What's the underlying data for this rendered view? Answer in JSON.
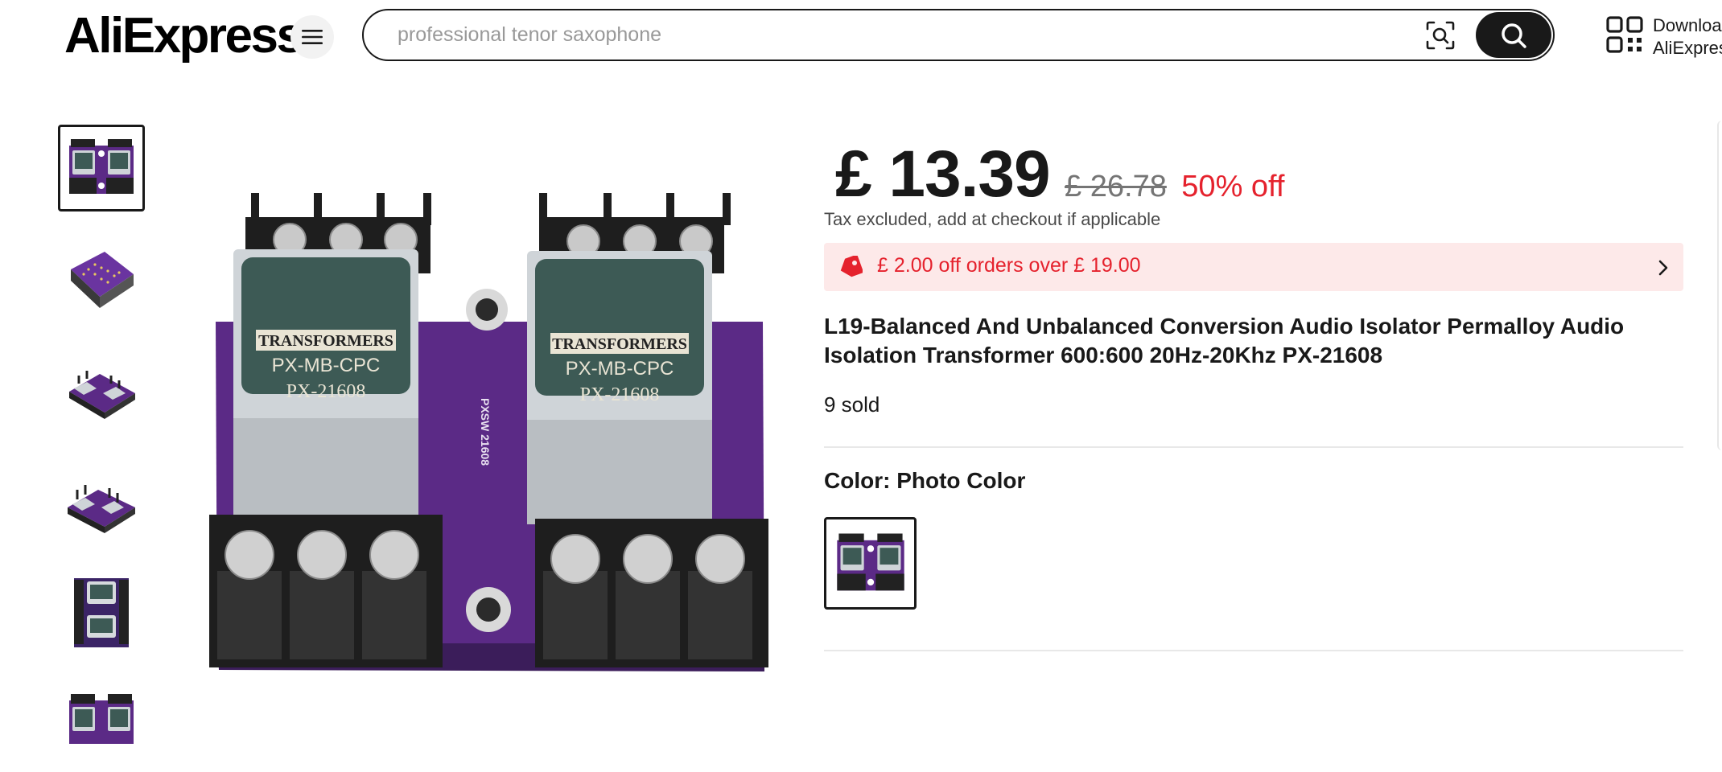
{
  "header": {
    "logo_text": "AliExpress",
    "search": {
      "value": "",
      "placeholder": "professional tenor saxophone"
    },
    "app_download": {
      "line1": "Downloa",
      "line2": "AliExpres"
    }
  },
  "gallery": {
    "thumbnails": [
      {
        "name": "thumbnail-1",
        "style": "front",
        "selected": true
      },
      {
        "name": "thumbnail-2",
        "style": "back-purple",
        "selected": false
      },
      {
        "name": "thumbnail-3",
        "style": "angle-left",
        "selected": false
      },
      {
        "name": "thumbnail-4",
        "style": "angle-right",
        "selected": false
      },
      {
        "name": "thumbnail-5",
        "style": "top-down",
        "selected": false
      },
      {
        "name": "thumbnail-6",
        "style": "side",
        "selected": false
      }
    ],
    "main_image": {
      "board_color": "#5b2a86",
      "left_label": [
        "TRANSFORMERS",
        "PX-MB-CPC",
        "PX-21608"
      ],
      "right_label": [
        "TRANSFORMERS",
        "PX-MB-CPC",
        "PX-21608"
      ],
      "silkscreen": "PXSW 21608"
    }
  },
  "product": {
    "price": "£ 13.39",
    "original_price": "£ 26.78",
    "discount": "50% off",
    "tax_note": "Tax excluded, add at checkout if applicable",
    "coupon": "£ 2.00 off orders over  £ 19.00",
    "title": "L19-Balanced And Unbalanced Conversion Audio Isolator Permalloy Audio Isolation Transformer 600:600 20Hz-20Khz PX-21608",
    "sold": "9 sold",
    "color_label": "Color: Photo Color"
  },
  "colors": {
    "accent": "#e5222d",
    "coupon_bg": "#fde9e9",
    "text": "#191919",
    "pcb": "#5b2a86"
  }
}
